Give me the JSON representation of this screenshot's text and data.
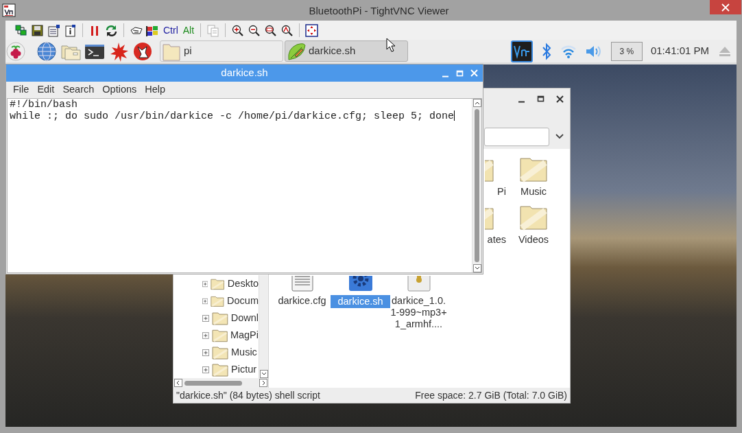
{
  "window": {
    "title": "BluetoothPi - TightVNC Viewer"
  },
  "toolbar": {
    "key_buttons": [
      {
        "label": "Ctrl",
        "color": "#1c1ca0"
      },
      {
        "label": "Alt",
        "color": "#1c8a1c"
      }
    ],
    "clipboard_disabled": true
  },
  "taskbar": {
    "task_buttons": [
      {
        "label": "pi",
        "kind": "folder",
        "selected": false
      },
      {
        "label": "darkice.sh",
        "kind": "editor",
        "selected": true
      }
    ],
    "cpu": "3 %",
    "clock": "01:41:01 PM"
  },
  "editor": {
    "title": "darkice.sh",
    "menu": [
      "File",
      "Edit",
      "Search",
      "Options",
      "Help"
    ],
    "lines": [
      "#!/bin/bash",
      "while :; do sudo /usr/bin/darkice -c /home/pi/darkice.cfg; sleep 5; done"
    ]
  },
  "file_manager": {
    "tree": [
      "Deskto",
      "Docum",
      "Downl",
      "MagPi",
      "Music",
      "Pictur"
    ],
    "items": [
      {
        "label": "Pi",
        "kind": "folder",
        "selected": false
      },
      {
        "label": "Music",
        "kind": "folder",
        "selected": false
      },
      {
        "label": "ates",
        "kind": "folder",
        "selected": false
      },
      {
        "label": "Videos",
        "kind": "folder",
        "selected": false
      },
      {
        "label": "darkice.cfg",
        "kind": "text-file",
        "selected": false
      },
      {
        "label": "darkice.sh",
        "kind": "script",
        "selected": true
      },
      {
        "label": "darkice_1.0.1-999~mp3+1_armhf....",
        "kind": "package",
        "selected": false
      }
    ],
    "status": "\"darkice.sh\" (84 bytes) shell script",
    "free_space": "Free space: 2.7 GiB (Total: 7.0 GiB)"
  }
}
